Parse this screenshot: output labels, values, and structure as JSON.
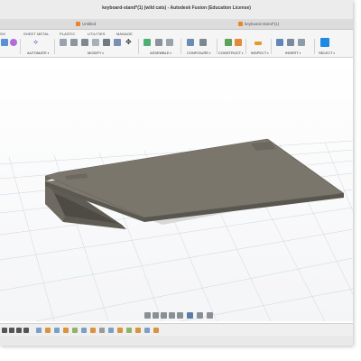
{
  "window": {
    "title": "keyboard-stand*(1) (wild cats) - Autodesk Fusion (Education License)"
  },
  "doc_tabs": [
    {
      "label": "Untitled"
    },
    {
      "label": "keyboard-stand*(1)"
    }
  ],
  "workspace_tabs": [
    "SH",
    "SHEET METAL",
    "PLASTIC",
    "UTILITIES",
    "MANAGE"
  ],
  "tool_groups": {
    "automate": "AUTOMATE",
    "modify": "MODIFY",
    "assemble": "ASSEMBLE",
    "configure": "CONFIGURE",
    "construct": "CONSTRUCT",
    "inspect": "INSPECT",
    "insert": "INSERT",
    "select": "SELECT"
  },
  "colors": {
    "model_top": "#7a766c",
    "model_side": "#5f5c54",
    "accent": "#0a6fc2",
    "select_blue": "#1e88e5"
  }
}
